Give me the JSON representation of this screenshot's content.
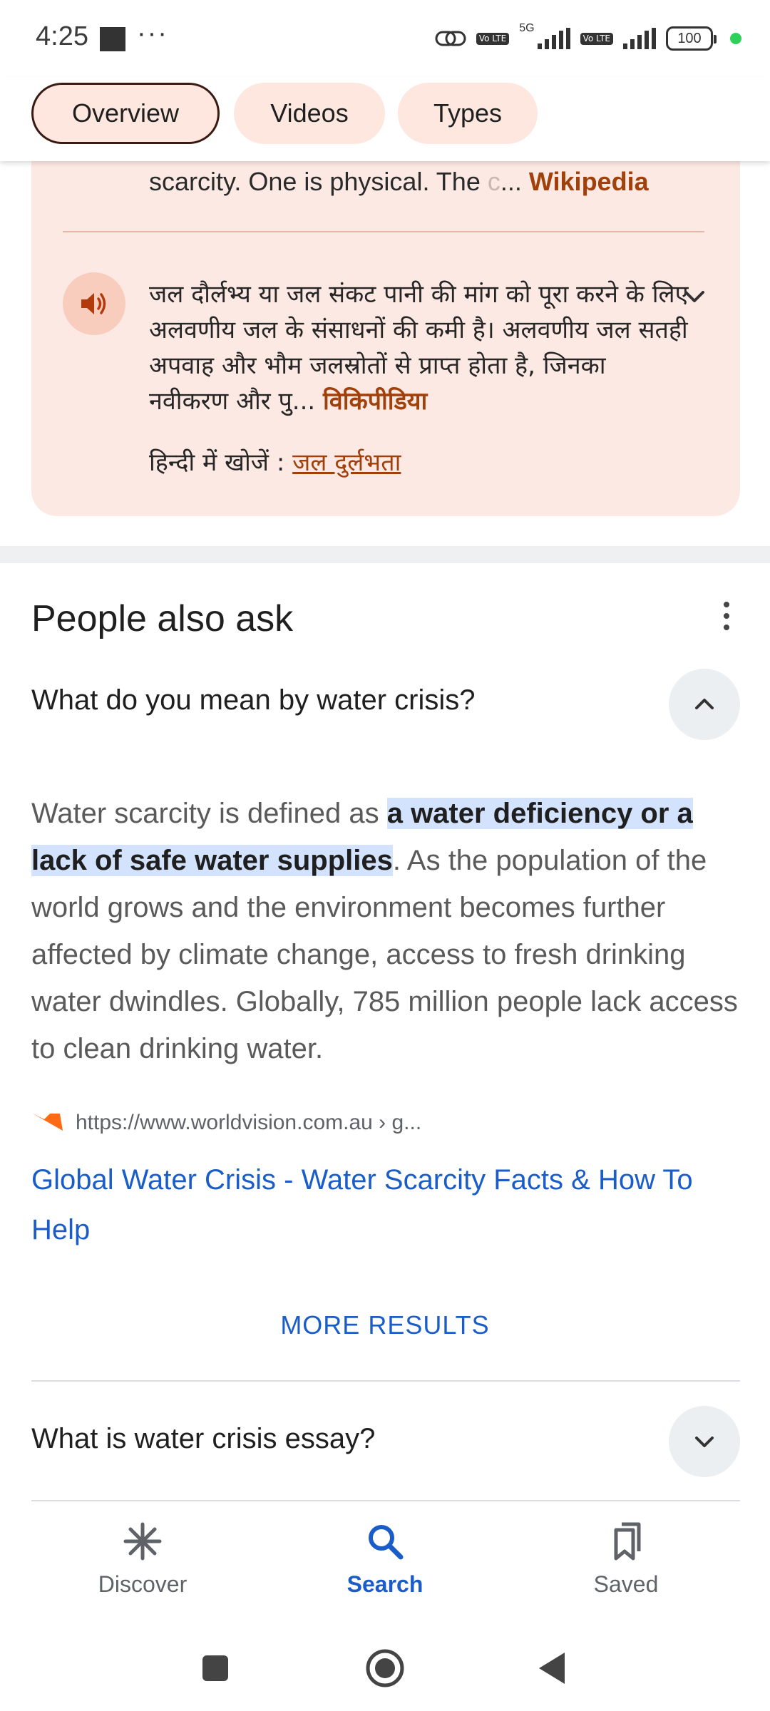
{
  "status_bar": {
    "time": "4:25",
    "dots": "···",
    "network_label": "5G",
    "volte_label": "Vo LTE",
    "battery": "100"
  },
  "tabs": [
    {
      "label": "Overview",
      "active": true
    },
    {
      "label": "Videos",
      "active": false
    },
    {
      "label": "Types",
      "active": false
    }
  ],
  "knowledge_card": {
    "wiki_snippet": "scarcity. One is physical. The ",
    "wiki_snippet_fade": "c",
    "ellipsis": "...",
    "wiki_source": "Wikipedia",
    "hindi_text": "जल दौर्लभ्य या जल संकट पानी की मांग को पूरा करने के लिए अलवणीय जल के संसाधनों की कमी है। अलवणीय जल सतही अपवाह और भौम जलस्रोतों से प्राप्त होता है, जिनका नवीकरण और पु",
    "hindi_text_fade": "ु",
    "hindi_source": "विकिपीडिया",
    "hindi_search_prefix": "हिन्दी में खोजें :",
    "hindi_search_link": "जल दुर्लभता",
    "accent_color": "#a0400a"
  },
  "people_also_ask": {
    "title": "People also ask",
    "questions": [
      {
        "question": "What do you mean by water crisis?",
        "expanded": true,
        "answer_before": "Water scarcity is defined as ",
        "answer_highlight": "a water deficiency or a lack of safe water supplies",
        "answer_after": ". As the population of the world grows and the environment becomes further affected by climate change, access to fresh drinking water dwindles. Globally, 785 million people lack access to clean drinking water.",
        "source_url": "https://www.worldvision.com.au › g...",
        "result_title": "Global Water Crisis - Water Scarcity Facts & How To Help"
      },
      {
        "question": "What is water crisis essay?",
        "expanded": false
      }
    ],
    "more_results": "MORE RESULTS"
  },
  "bottom_nav": [
    {
      "label": "Discover",
      "icon": "asterisk-icon",
      "active": false
    },
    {
      "label": "Search",
      "icon": "search-icon",
      "active": true
    },
    {
      "label": "Saved",
      "icon": "bookmarks-icon",
      "active": false
    }
  ],
  "colors": {
    "link_blue": "#1a5dc8",
    "card_bg": "#fde9e3",
    "highlight_bg": "#d3e3fd"
  }
}
